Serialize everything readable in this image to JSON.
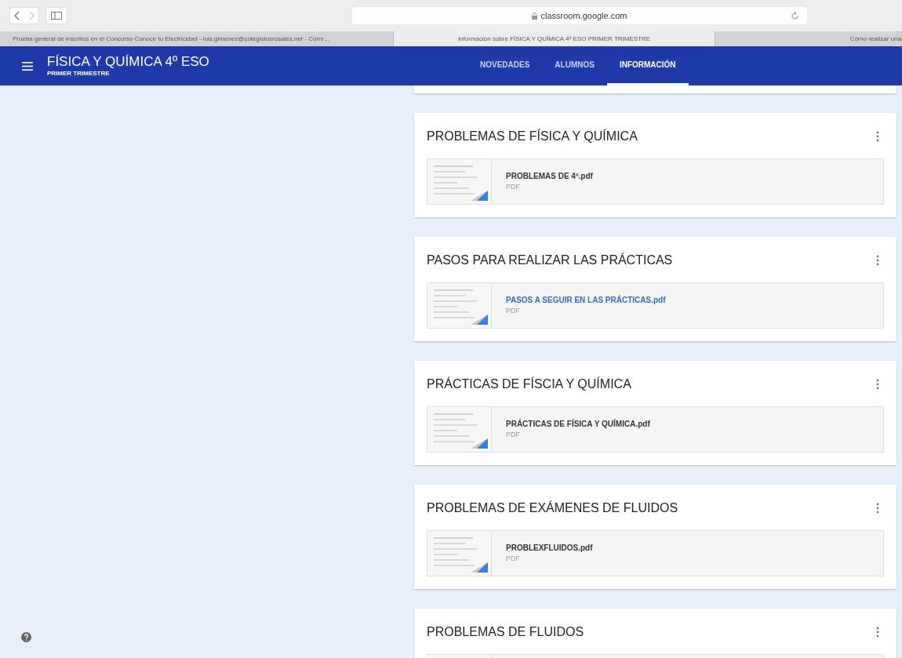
{
  "browser": {
    "url": "classroom.google.com",
    "tabs": [
      {
        "title": "Prueba general de inscritos en el Concurso Conoce tu Electricidad - luis.gimenez@colegiolosrosales.net - Corre...",
        "selected": false
      },
      {
        "title": "Información sobre FÍSICA Y QUÍMICA 4º ESO PRIMER TRIMESTRE",
        "selected": true
      },
      {
        "title": "Cómo realizar una",
        "selected": false
      }
    ]
  },
  "header": {
    "title": "FÍSICA Y QUÍMICA 4º ESO",
    "subtitle": "PRIMER TRIMESTRE",
    "tabs": [
      {
        "label": "NOVEDADES",
        "selected": false
      },
      {
        "label": "ALUMNOS",
        "selected": false
      },
      {
        "label": "INFORMACIÓN",
        "selected": true
      }
    ]
  },
  "sections": [
    {
      "title": "PROBLEMAS DE FÍSICA Y QUÍMICA",
      "file": {
        "name": "PROBLEMAS DE 4º.pdf",
        "type": "PDF",
        "link": false
      }
    },
    {
      "title": "PASOS PARA REALIZAR LAS PRÁCTICAS",
      "file": {
        "name": "PASOS A SEGUIR EN LAS PRÁCTICAS.pdf",
        "type": "PDF",
        "link": true
      }
    },
    {
      "title": "PRÁCTICAS DE FÍSCIA Y QUÍMICA",
      "file": {
        "name": "PRÁCTICAS DE FÍSICA Y QUÍMICA.pdf",
        "type": "PDF",
        "link": false
      }
    },
    {
      "title": "PROBLEMAS DE EXÁMENES DE FLUIDOS",
      "file": {
        "name": "PROBLEXFLUIDOS.pdf",
        "type": "PDF",
        "link": false
      }
    },
    {
      "title": "PROBLEMAS DE FLUIDOS"
    }
  ]
}
